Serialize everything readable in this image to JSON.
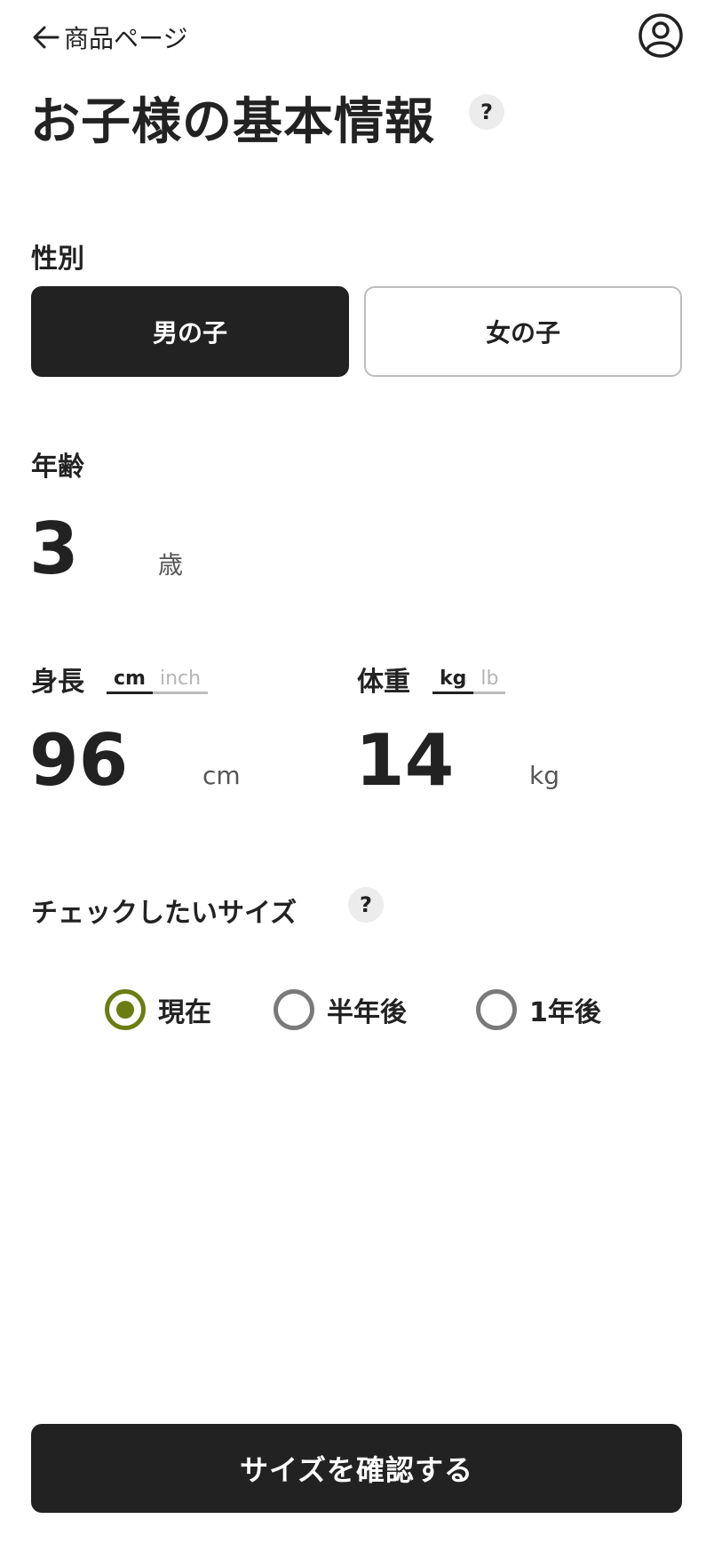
{
  "header": {
    "back_label": "商品ページ",
    "back_icon": "arrow-left-icon",
    "account_icon": "user-circle-icon"
  },
  "title": "お子様の基本情報",
  "help_mark": "?",
  "gender": {
    "label": "性別",
    "options": [
      "男の子",
      "女の子"
    ],
    "selected": "男の子"
  },
  "age": {
    "label": "年齢",
    "value": "3",
    "unit": "歳"
  },
  "height": {
    "label": "身長",
    "units": [
      "cm",
      "inch"
    ],
    "selected_unit": "cm",
    "value": "96",
    "unit": "cm"
  },
  "weight": {
    "label": "体重",
    "units": [
      "kg",
      "lb"
    ],
    "selected_unit": "kg",
    "value": "14",
    "unit": "kg"
  },
  "size_check": {
    "label": "チェックしたいサイズ",
    "options": [
      "現在",
      "半年後",
      "1年後"
    ],
    "selected": "現在"
  },
  "confirm_label": "サイズを確認する",
  "colors": {
    "primary": "#222222",
    "accent": "#6b7d12",
    "border": "#bdbdbd"
  }
}
